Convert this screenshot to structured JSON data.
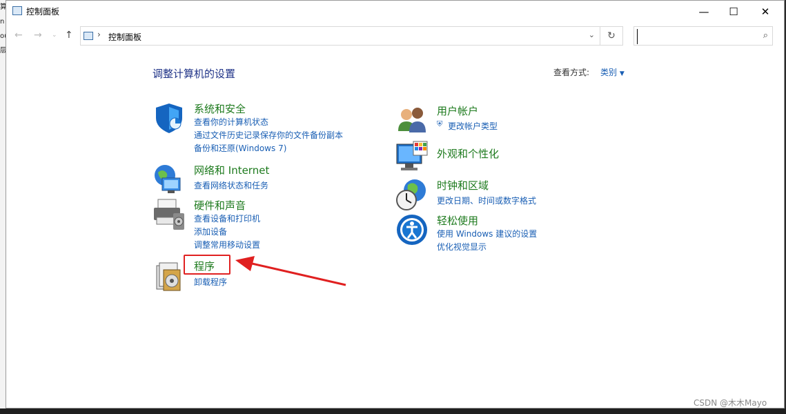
{
  "window": {
    "title": "控制面板",
    "minimize": "—",
    "maximize": "☐",
    "close": "✕"
  },
  "address": {
    "path": "控制面板",
    "separator": "›",
    "search_placeholder": ""
  },
  "page": {
    "heading": "调整计算机的设置",
    "view_by_label": "查看方式:",
    "view_by_value": "类别"
  },
  "categories": [
    {
      "title": "系统和安全",
      "links": [
        "查看你的计算机状态",
        "通过文件历史记录保存你的文件备份副本",
        "备份和还原(Windows 7)"
      ]
    },
    {
      "title": "网络和 Internet",
      "links": [
        "查看网络状态和任务"
      ]
    },
    {
      "title": "硬件和声音",
      "links": [
        "查看设备和打印机",
        "添加设备",
        "调整常用移动设置"
      ]
    },
    {
      "title": "程序",
      "links": [
        "卸载程序"
      ]
    },
    {
      "title": "用户帐户",
      "links": [
        "更改帐户类型"
      ]
    },
    {
      "title": "外观和个性化",
      "links": []
    },
    {
      "title": "时钟和区域",
      "links": [
        "更改日期、时间或数字格式"
      ]
    },
    {
      "title": "轻松使用",
      "links": [
        "使用 Windows 建议的设置",
        "优化视觉显示"
      ]
    }
  ],
  "background_text": [
    "算",
    "n",
    "ou",
    "层"
  ],
  "watermark": "CSDN @木木Mayo",
  "icons": [
    "shield-icon",
    "network-icon",
    "printer-icon",
    "programs-icon",
    "users-icon",
    "monitor-icon",
    "clock-icon",
    "accessibility-icon"
  ],
  "colors": {
    "link": "#1a5fb4",
    "category_title": "#1d7a1d",
    "heading": "#1e3287",
    "annotation": "#e02020"
  }
}
